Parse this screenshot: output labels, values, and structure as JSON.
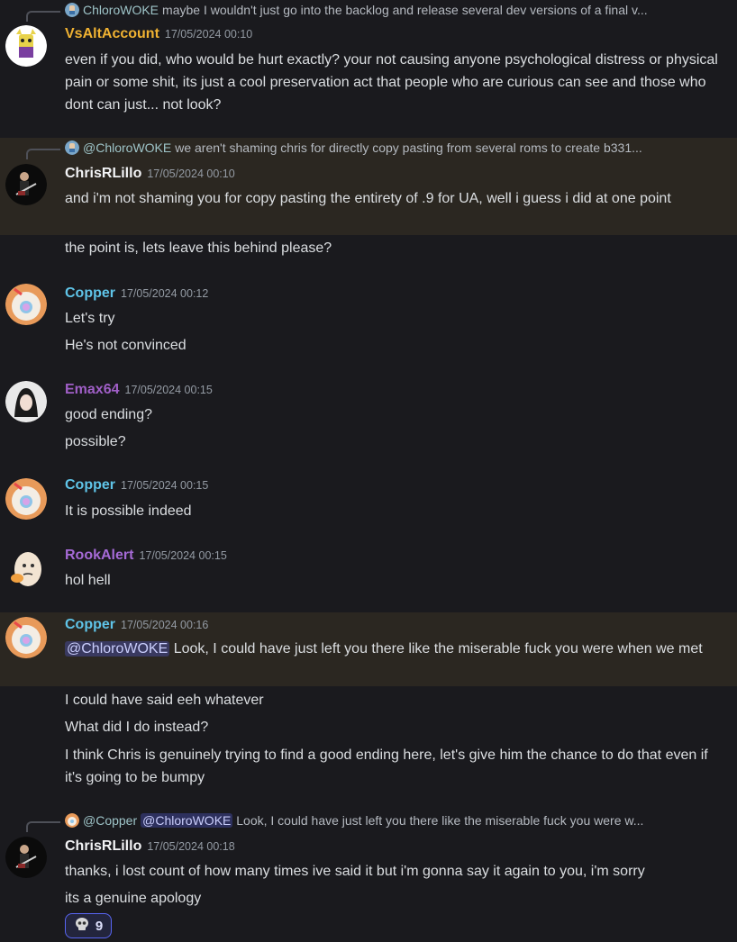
{
  "colors": {
    "background": "#1a1a1e",
    "highlight": "#2b2721",
    "mention_bg": "#3b3f75",
    "reaction_border": "#5865f2"
  },
  "messages": [
    {
      "reply": {
        "name": "ChloroWOKE",
        "text": "maybe I wouldn't just go into the backlog and release several dev versions of a final v..."
      },
      "author": "VsAltAccount",
      "timestamp": "17/05/2024 00:10",
      "lines": [
        "even if you did, who would be hurt exactly? your not causing anyone psychological distress or physical pain or some shit, its just a cool preservation act that people who are curious can see and those who dont can just... not look?"
      ]
    },
    {
      "reply": {
        "name": "@ChloroWOKE",
        "text": "we aren't shaming chris for directly copy pasting from several roms to create b331..."
      },
      "author": "ChrisRLillo",
      "timestamp": "17/05/2024 00:10",
      "lines": [
        "and i'm not shaming you for copy pasting the entirety of .9 for UA, well i guess i did at one point",
        "the point is, lets leave this behind please?"
      ]
    },
    {
      "author": "Copper",
      "timestamp": "17/05/2024 00:12",
      "lines": [
        "Let's try",
        "He's not convinced"
      ]
    },
    {
      "author": "Emax64",
      "timestamp": "17/05/2024 00:15",
      "lines": [
        "good ending?",
        "possible?"
      ]
    },
    {
      "author": "Copper",
      "timestamp": "17/05/2024 00:15",
      "lines": [
        "It is possible indeed"
      ]
    },
    {
      "author": "RookAlert",
      "timestamp": "17/05/2024 00:15",
      "lines": [
        "hol hell"
      ]
    },
    {
      "author": "Copper",
      "timestamp": "17/05/2024 00:16",
      "mention": "@ChloroWOKE",
      "lines": [
        "Look, I could have just left you there like the miserable fuck you were when we met",
        "I could have said eeh whatever",
        "What did I do instead?",
        "I think Chris is genuinely trying to find a good ending here, let's give him the chance to do that even if it's going to be bumpy"
      ]
    },
    {
      "reply": {
        "name": "@Copper",
        "mention": "@ChloroWOKE",
        "text": "Look, I could have just left you there like the miserable fuck you were w..."
      },
      "author": "ChrisRLillo",
      "timestamp": "17/05/2024 00:18",
      "lines": [
        "thanks, i lost count of how many times ive said it but i'm gonna say it again to you, i'm sorry",
        "its a genuine apology"
      ],
      "reaction": {
        "icon": "skull-emoji-icon",
        "count": "9"
      }
    }
  ]
}
